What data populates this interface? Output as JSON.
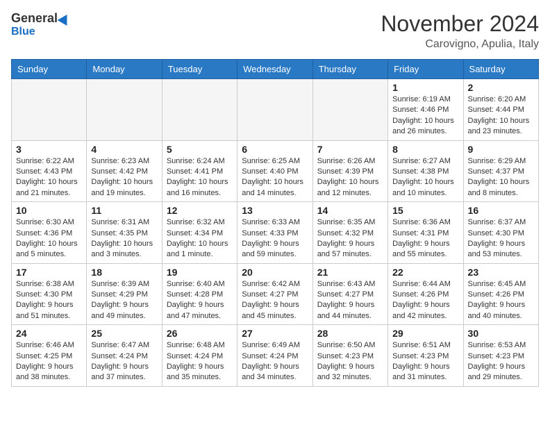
{
  "header": {
    "logo_general": "General",
    "logo_blue": "Blue",
    "month_title": "November 2024",
    "location": "Carovigno, Apulia, Italy"
  },
  "days_of_week": [
    "Sunday",
    "Monday",
    "Tuesday",
    "Wednesday",
    "Thursday",
    "Friday",
    "Saturday"
  ],
  "weeks": [
    [
      {
        "day": "",
        "info": ""
      },
      {
        "day": "",
        "info": ""
      },
      {
        "day": "",
        "info": ""
      },
      {
        "day": "",
        "info": ""
      },
      {
        "day": "",
        "info": ""
      },
      {
        "day": "1",
        "info": "Sunrise: 6:19 AM\nSunset: 4:46 PM\nDaylight: 10 hours\nand 26 minutes."
      },
      {
        "day": "2",
        "info": "Sunrise: 6:20 AM\nSunset: 4:44 PM\nDaylight: 10 hours\nand 23 minutes."
      }
    ],
    [
      {
        "day": "3",
        "info": "Sunrise: 6:22 AM\nSunset: 4:43 PM\nDaylight: 10 hours\nand 21 minutes."
      },
      {
        "day": "4",
        "info": "Sunrise: 6:23 AM\nSunset: 4:42 PM\nDaylight: 10 hours\nand 19 minutes."
      },
      {
        "day": "5",
        "info": "Sunrise: 6:24 AM\nSunset: 4:41 PM\nDaylight: 10 hours\nand 16 minutes."
      },
      {
        "day": "6",
        "info": "Sunrise: 6:25 AM\nSunset: 4:40 PM\nDaylight: 10 hours\nand 14 minutes."
      },
      {
        "day": "7",
        "info": "Sunrise: 6:26 AM\nSunset: 4:39 PM\nDaylight: 10 hours\nand 12 minutes."
      },
      {
        "day": "8",
        "info": "Sunrise: 6:27 AM\nSunset: 4:38 PM\nDaylight: 10 hours\nand 10 minutes."
      },
      {
        "day": "9",
        "info": "Sunrise: 6:29 AM\nSunset: 4:37 PM\nDaylight: 10 hours\nand 8 minutes."
      }
    ],
    [
      {
        "day": "10",
        "info": "Sunrise: 6:30 AM\nSunset: 4:36 PM\nDaylight: 10 hours\nand 5 minutes."
      },
      {
        "day": "11",
        "info": "Sunrise: 6:31 AM\nSunset: 4:35 PM\nDaylight: 10 hours\nand 3 minutes."
      },
      {
        "day": "12",
        "info": "Sunrise: 6:32 AM\nSunset: 4:34 PM\nDaylight: 10 hours\nand 1 minute."
      },
      {
        "day": "13",
        "info": "Sunrise: 6:33 AM\nSunset: 4:33 PM\nDaylight: 9 hours\nand 59 minutes."
      },
      {
        "day": "14",
        "info": "Sunrise: 6:35 AM\nSunset: 4:32 PM\nDaylight: 9 hours\nand 57 minutes."
      },
      {
        "day": "15",
        "info": "Sunrise: 6:36 AM\nSunset: 4:31 PM\nDaylight: 9 hours\nand 55 minutes."
      },
      {
        "day": "16",
        "info": "Sunrise: 6:37 AM\nSunset: 4:30 PM\nDaylight: 9 hours\nand 53 minutes."
      }
    ],
    [
      {
        "day": "17",
        "info": "Sunrise: 6:38 AM\nSunset: 4:30 PM\nDaylight: 9 hours\nand 51 minutes."
      },
      {
        "day": "18",
        "info": "Sunrise: 6:39 AM\nSunset: 4:29 PM\nDaylight: 9 hours\nand 49 minutes."
      },
      {
        "day": "19",
        "info": "Sunrise: 6:40 AM\nSunset: 4:28 PM\nDaylight: 9 hours\nand 47 minutes."
      },
      {
        "day": "20",
        "info": "Sunrise: 6:42 AM\nSunset: 4:27 PM\nDaylight: 9 hours\nand 45 minutes."
      },
      {
        "day": "21",
        "info": "Sunrise: 6:43 AM\nSunset: 4:27 PM\nDaylight: 9 hours\nand 44 minutes."
      },
      {
        "day": "22",
        "info": "Sunrise: 6:44 AM\nSunset: 4:26 PM\nDaylight: 9 hours\nand 42 minutes."
      },
      {
        "day": "23",
        "info": "Sunrise: 6:45 AM\nSunset: 4:26 PM\nDaylight: 9 hours\nand 40 minutes."
      }
    ],
    [
      {
        "day": "24",
        "info": "Sunrise: 6:46 AM\nSunset: 4:25 PM\nDaylight: 9 hours\nand 38 minutes."
      },
      {
        "day": "25",
        "info": "Sunrise: 6:47 AM\nSunset: 4:24 PM\nDaylight: 9 hours\nand 37 minutes."
      },
      {
        "day": "26",
        "info": "Sunrise: 6:48 AM\nSunset: 4:24 PM\nDaylight: 9 hours\nand 35 minutes."
      },
      {
        "day": "27",
        "info": "Sunrise: 6:49 AM\nSunset: 4:24 PM\nDaylight: 9 hours\nand 34 minutes."
      },
      {
        "day": "28",
        "info": "Sunrise: 6:50 AM\nSunset: 4:23 PM\nDaylight: 9 hours\nand 32 minutes."
      },
      {
        "day": "29",
        "info": "Sunrise: 6:51 AM\nSunset: 4:23 PM\nDaylight: 9 hours\nand 31 minutes."
      },
      {
        "day": "30",
        "info": "Sunrise: 6:53 AM\nSunset: 4:23 PM\nDaylight: 9 hours\nand 29 minutes."
      }
    ]
  ]
}
